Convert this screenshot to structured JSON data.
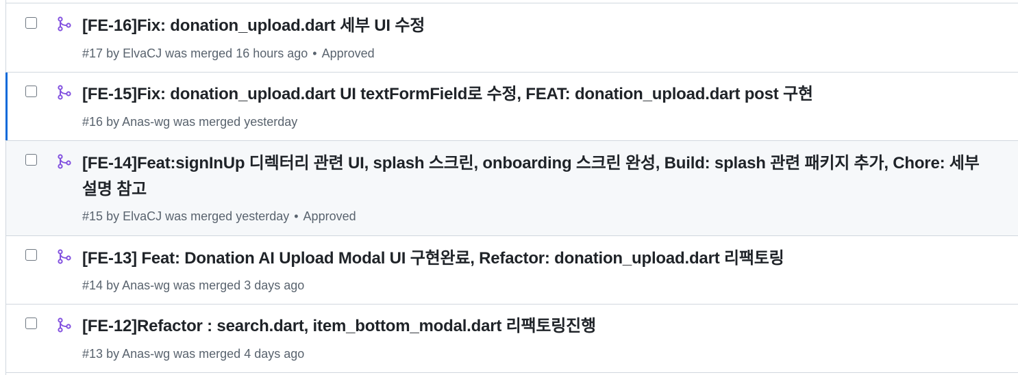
{
  "pull_requests": [
    {
      "title": "[FE-16]Fix: donation_upload.dart 세부 UI 수정",
      "number": "#17",
      "by": "by",
      "author": "ElvaCJ",
      "state_text": "was merged",
      "time": "16 hours ago",
      "separator": "•",
      "review": "Approved"
    },
    {
      "title": "[FE-15]Fix: donation_upload.dart UI textFormField로 수정, FEAT: donation_upload.dart post 구현",
      "number": "#16",
      "by": "by",
      "author": "Anas-wg",
      "state_text": "was merged",
      "time": "yesterday"
    },
    {
      "title": "[FE-14]Feat:signInUp 디렉터리 관련 UI, splash 스크린, onboarding 스크린 완성, Build: splash 관련 패키지 추가, Chore: 세부 설명 참고",
      "number": "#15",
      "by": "by",
      "author": "ElvaCJ",
      "state_text": "was merged",
      "time": "yesterday",
      "separator": "•",
      "review": "Approved"
    },
    {
      "title": "[FE-13] Feat: Donation AI Upload Modal UI 구현완료, Refactor: donation_upload.dart 리팩토링",
      "number": "#14",
      "by": "by",
      "author": "Anas-wg",
      "state_text": "was merged",
      "time": "3 days ago"
    },
    {
      "title": "[FE-12]Refactor : search.dart, item_bottom_modal.dart 리팩토링진행",
      "number": "#13",
      "by": "by",
      "author": "Anas-wg",
      "state_text": "was merged",
      "time": "4 days ago"
    }
  ],
  "icons": {
    "merged": "git-merge-icon"
  },
  "colors": {
    "merged_icon": "#8250df",
    "selected_accent": "#0969da",
    "hover_bg": "#f6f8fa",
    "title": "#1f2328",
    "meta": "#59636e"
  }
}
